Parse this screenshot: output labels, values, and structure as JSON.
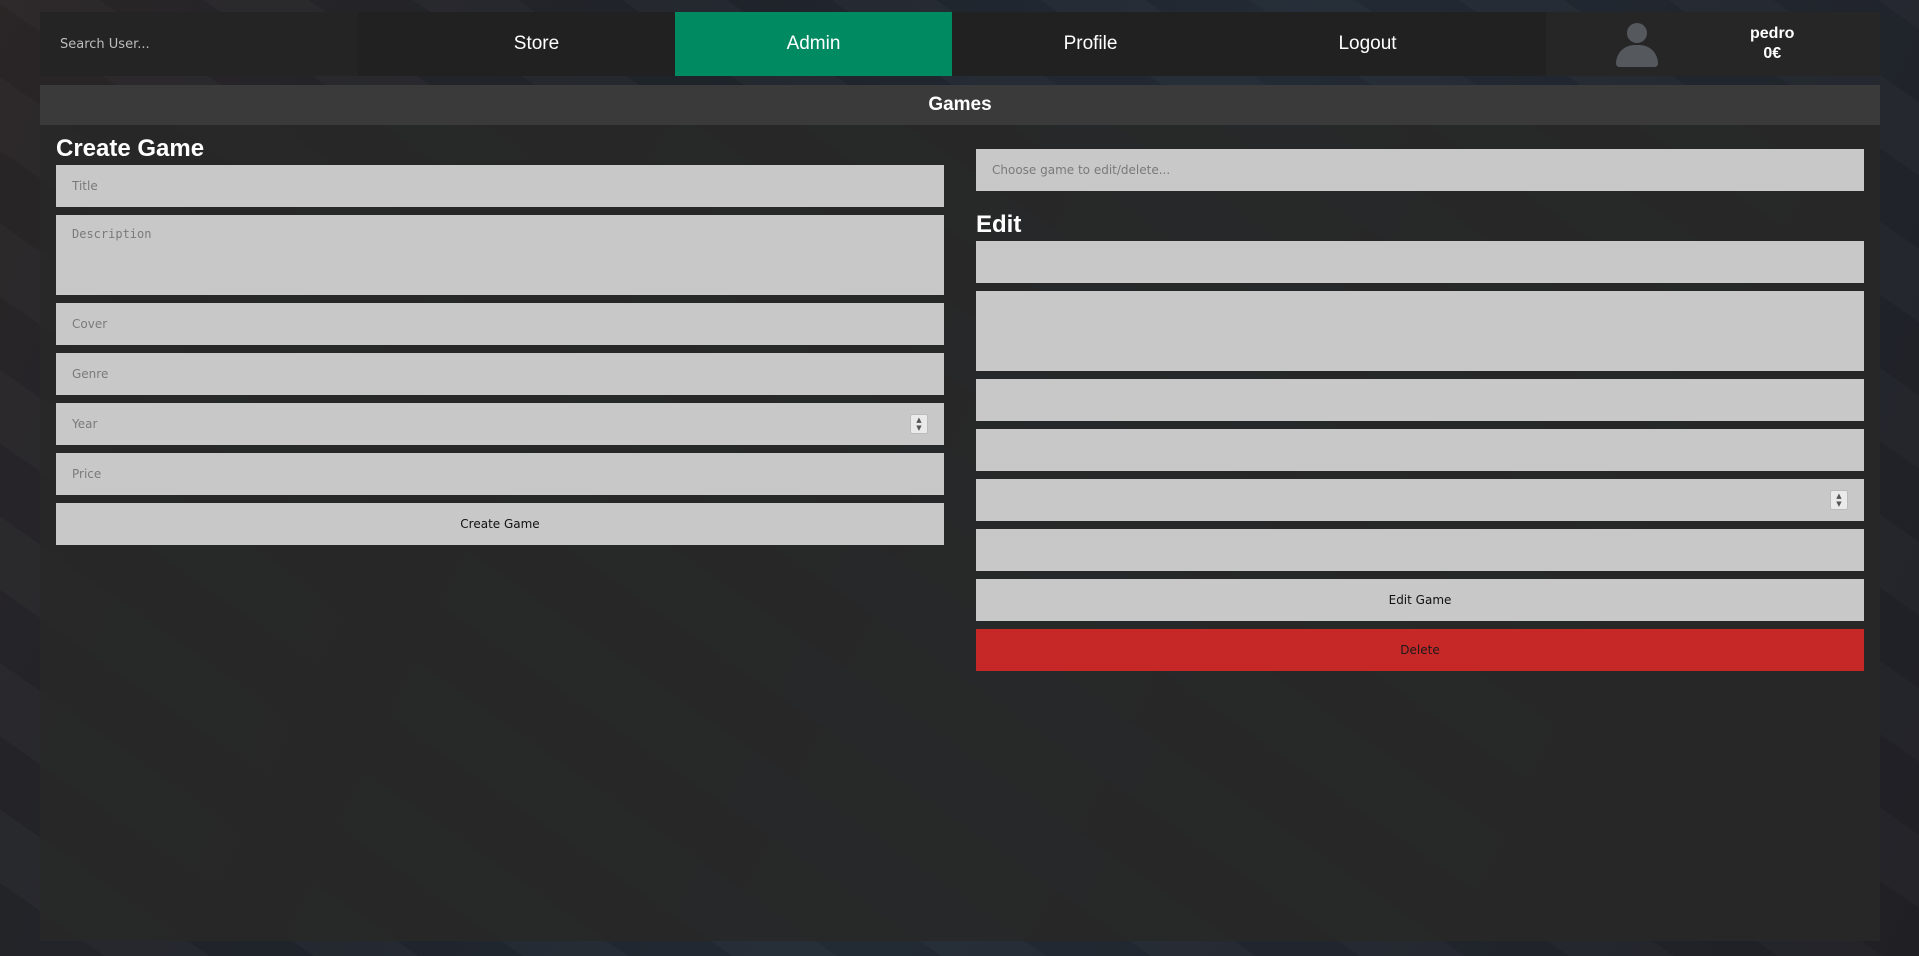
{
  "search": {
    "placeholder": "Search User..."
  },
  "nav": {
    "store": "Store",
    "admin": "Admin",
    "profile": "Profile",
    "logout": "Logout"
  },
  "user": {
    "name": "pedro",
    "balance": "0€"
  },
  "page": {
    "title": "Games"
  },
  "create": {
    "heading": "Create Game",
    "title_placeholder": "Title",
    "description_placeholder": "Description",
    "cover_placeholder": "Cover",
    "genre_placeholder": "Genre",
    "year_placeholder": "Year",
    "price_placeholder": "Price",
    "submit_label": "Create Game"
  },
  "edit": {
    "select_placeholder": "Choose game to edit/delete...",
    "heading": "Edit",
    "submit_label": "Edit Game",
    "delete_label": "Delete"
  },
  "colors": {
    "accent": "#008a62",
    "danger": "#c62828",
    "field": "#c8c8c8"
  }
}
